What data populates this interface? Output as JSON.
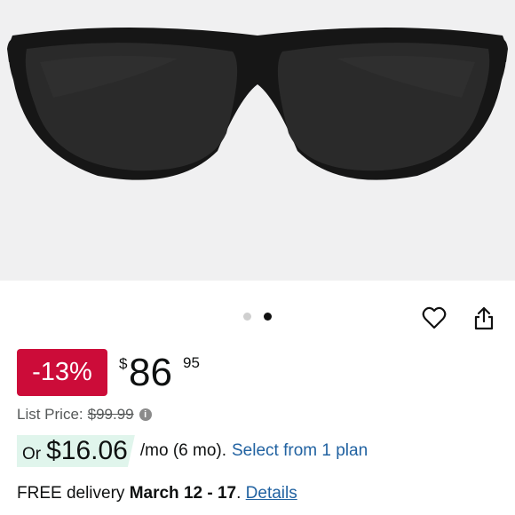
{
  "product": {
    "image_alt": "Black wrap sunglasses",
    "gallery": {
      "dots": 2,
      "active_index": 1
    }
  },
  "actions": {
    "favorite_icon": "heart-icon",
    "share_icon": "share-icon"
  },
  "pricing": {
    "discount": "-13%",
    "currency_symbol": "$",
    "price_whole": "86",
    "price_fraction": "95",
    "list_price_label": "List Price:",
    "list_price": "$99.99"
  },
  "financing": {
    "prefix": "Or",
    "amount": "$16.06",
    "term": "/mo (6 mo).",
    "plan_link": "Select from 1 plan"
  },
  "delivery": {
    "prefix": "FREE delivery",
    "dates": "March 12 - 17",
    "suffix": ".",
    "details_link": "Details"
  },
  "colors": {
    "badge": "#cc0c39",
    "link": "#2162a1",
    "finance_highlight": "#e0f5ec",
    "image_bg": "#f0f0f1"
  }
}
